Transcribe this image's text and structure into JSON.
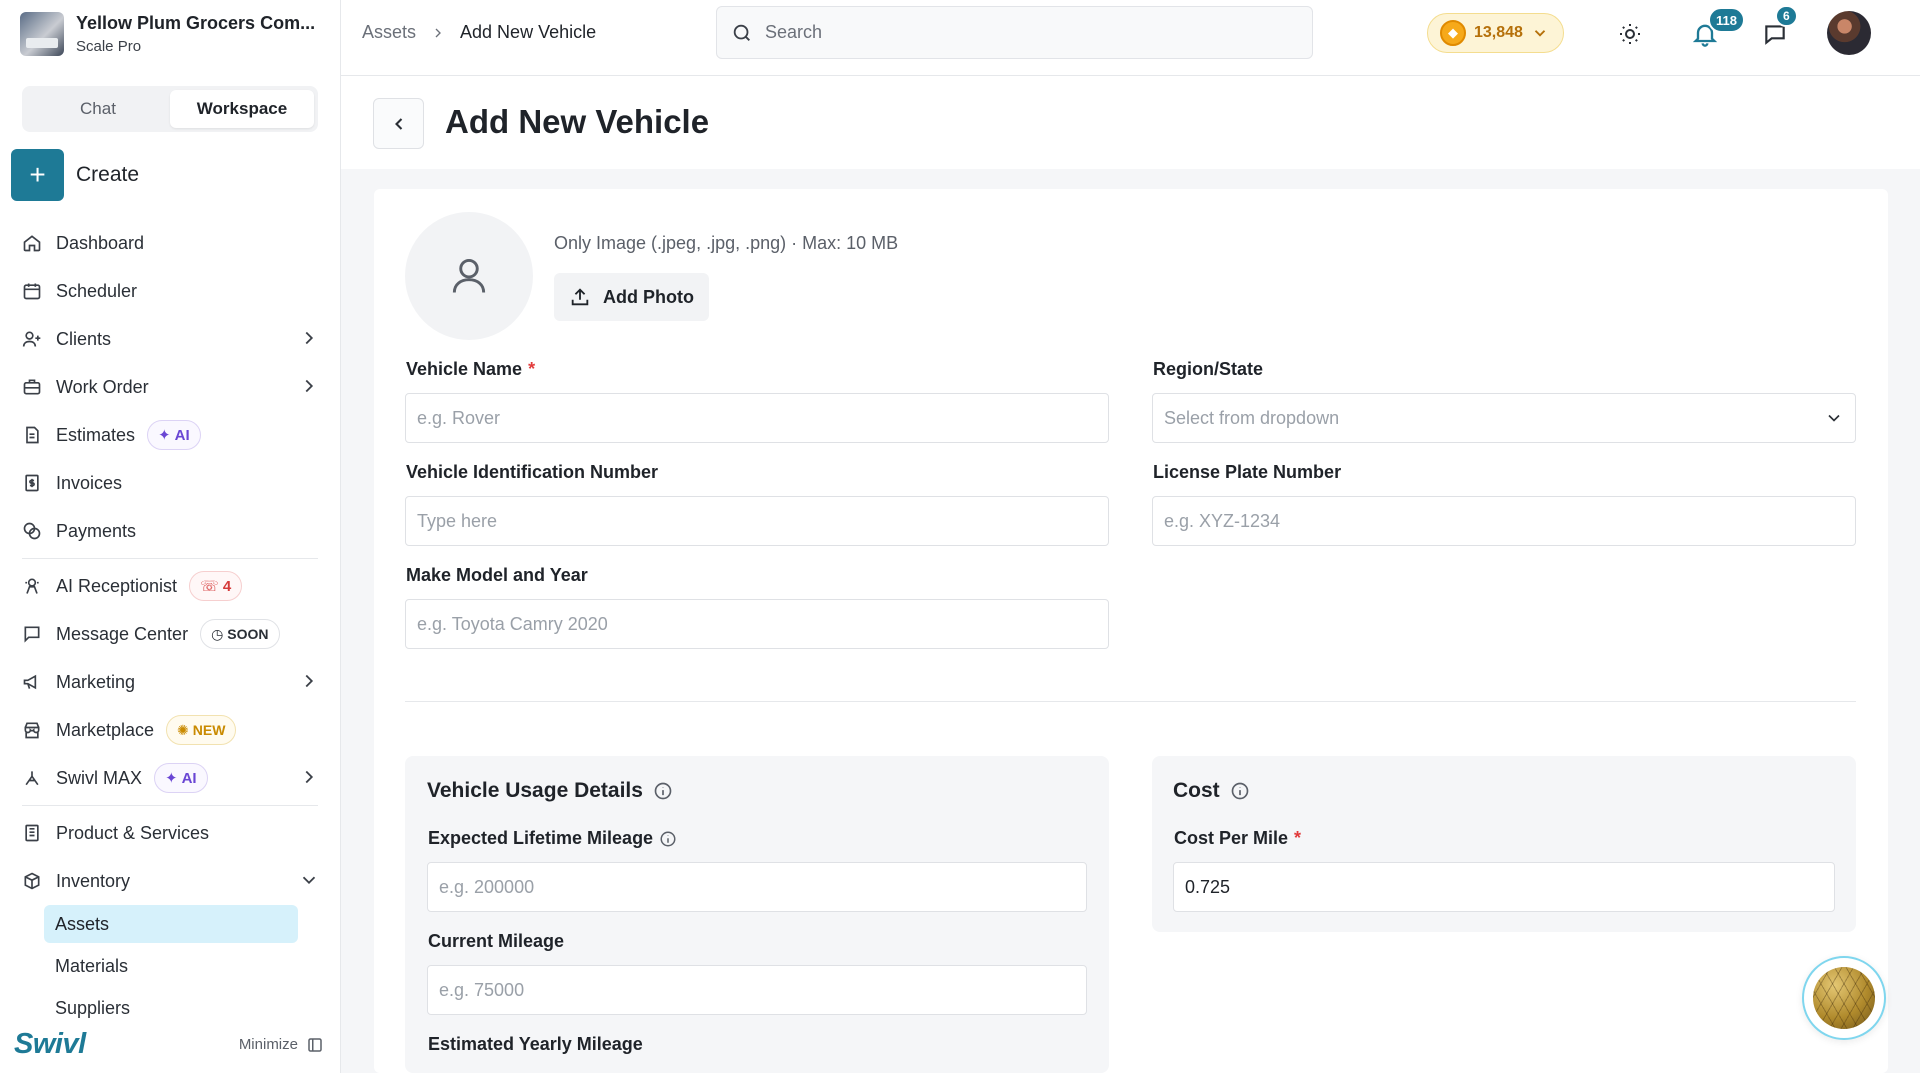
{
  "sidebar": {
    "org_name": "Yellow Plum Grocers Com...",
    "org_plan": "Scale Pro",
    "tabs": [
      {
        "label": "Chat"
      },
      {
        "label": "Workspace"
      }
    ],
    "create_label": "Create",
    "items": [
      {
        "label": "Dashboard",
        "icon": "home-icon"
      },
      {
        "label": "Scheduler",
        "icon": "calendar-icon"
      },
      {
        "label": "Clients",
        "icon": "user-plus-icon"
      },
      {
        "label": "Work Order",
        "icon": "briefcase-icon"
      },
      {
        "label": "Estimates",
        "icon": "document-icon",
        "badge": "AI"
      },
      {
        "label": "Invoices",
        "icon": "invoice-icon"
      },
      {
        "label": "Payments",
        "icon": "coins-icon"
      },
      {
        "label": "AI Receptionist",
        "icon": "receptionist-icon",
        "badge": "4"
      },
      {
        "label": "Message Center",
        "icon": "message-icon",
        "badge": "SOON"
      },
      {
        "label": "Marketing",
        "icon": "megaphone-icon"
      },
      {
        "label": "Marketplace",
        "icon": "store-icon",
        "badge": "NEW"
      },
      {
        "label": "Swivl MAX",
        "icon": "max-icon",
        "badge": "AI"
      },
      {
        "label": "Product & Services",
        "icon": "catalog-icon"
      },
      {
        "label": "Inventory",
        "icon": "box-icon"
      }
    ],
    "inventory_sub": [
      {
        "label": "Assets"
      },
      {
        "label": "Materials"
      },
      {
        "label": "Suppliers"
      }
    ],
    "brand": "Swivl",
    "minimize_label": "Minimize"
  },
  "topbar": {
    "breadcrumb": [
      "Assets",
      "Add New Vehicle"
    ],
    "search_placeholder": "Search",
    "coins": "13,848",
    "notifications": "118",
    "messages": "6"
  },
  "page": {
    "title": "Add New Vehicle",
    "photo_hint": "Only Image (.jpeg, .jpg, .png) · Max: 10 MB",
    "add_photo_label": "Add Photo"
  },
  "form": {
    "vehicle_name": {
      "label": "Vehicle Name",
      "placeholder": "e.g. Rover",
      "value": ""
    },
    "region": {
      "label": "Region/State",
      "placeholder": "Select from dropdown"
    },
    "vin": {
      "label": "Vehicle Identification Number",
      "placeholder": "Type here",
      "value": ""
    },
    "plate": {
      "label": "License Plate Number",
      "placeholder": "e.g. XYZ-1234",
      "value": ""
    },
    "make": {
      "label": "Make Model and Year",
      "placeholder": "e.g. Toyota Camry 2020",
      "value": ""
    }
  },
  "usage": {
    "title": "Vehicle Usage Details",
    "lifetime": {
      "label": "Expected Lifetime Mileage",
      "placeholder": "e.g. 200000"
    },
    "current": {
      "label": "Current Mileage",
      "placeholder": "e.g. 75000"
    },
    "yearly": {
      "label": "Estimated Yearly Mileage"
    }
  },
  "cost": {
    "title": "Cost",
    "per_mile": {
      "label": "Cost Per Mile",
      "value": "0.725"
    }
  },
  "colors": {
    "accent": "#1e7a96",
    "active_sub_bg": "#d6f1fb",
    "required": "#e23b3b"
  }
}
